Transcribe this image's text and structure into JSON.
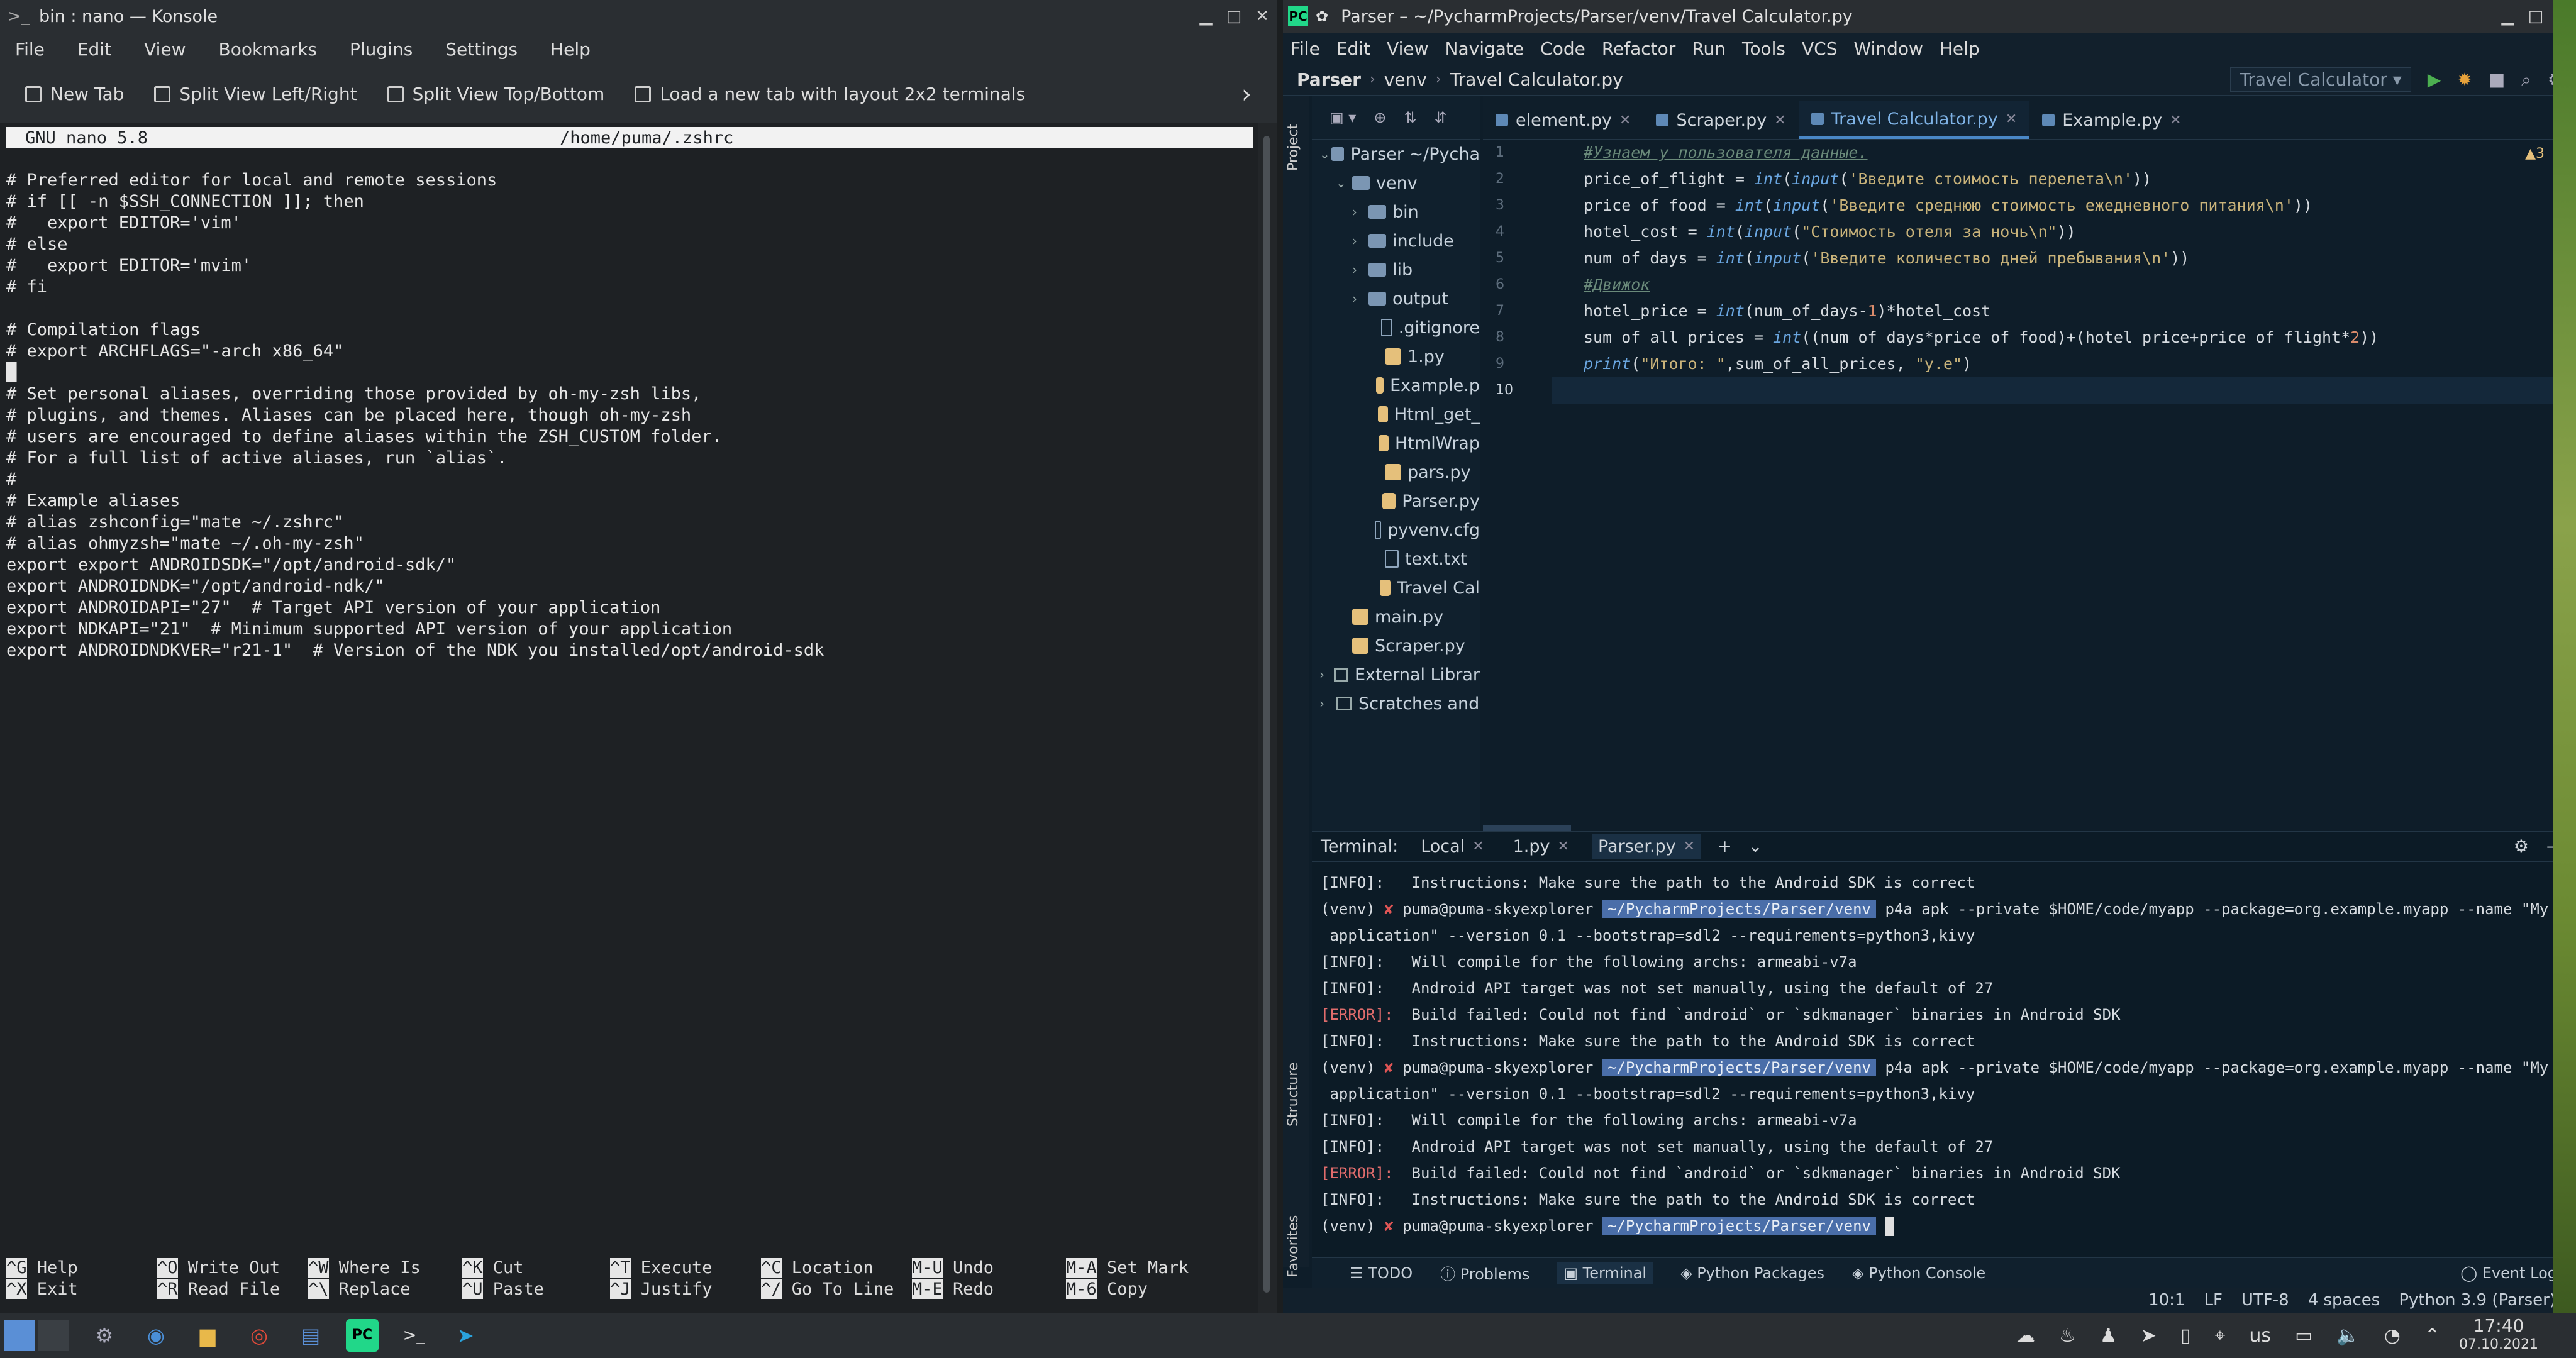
{
  "konsole": {
    "title": "bin : nano — Konsole",
    "menu": [
      "File",
      "Edit",
      "View",
      "Bookmarks",
      "Plugins",
      "Settings",
      "Help"
    ],
    "toolbar": {
      "new_tab": "New Tab",
      "split_lr": "Split View Left/Right",
      "split_tb": "Split View Top/Bottom",
      "load_layout": "Load a new tab with layout 2x2 terminals"
    },
    "nano": {
      "version": "GNU nano 5.8",
      "file": "/home/puma/.zshrc",
      "lines": [
        "# Preferred editor for local and remote sessions",
        "# if [[ -n $SSH_CONNECTION ]]; then",
        "#   export EDITOR='vim'",
        "# else",
        "#   export EDITOR='mvim'",
        "# fi",
        "",
        "# Compilation flags",
        "# export ARCHFLAGS=\"-arch x86_64\"",
        "",
        "# Set personal aliases, overriding those provided by oh-my-zsh libs,",
        "# plugins, and themes. Aliases can be placed here, though oh-my-zsh",
        "# users are encouraged to define aliases within the ZSH_CUSTOM folder.",
        "# For a full list of active aliases, run `alias`.",
        "#",
        "# Example aliases",
        "# alias zshconfig=\"mate ~/.zshrc\"",
        "# alias ohmyzsh=\"mate ~/.oh-my-zsh\"",
        "export export ANDROIDSDK=\"/opt/android-sdk/\"",
        "export ANDROIDNDK=\"/opt/android-ndk/\"",
        "export ANDROIDAPI=\"27\"  # Target API version of your application",
        "export NDKAPI=\"21\"  # Minimum supported API version of your application",
        "export ANDROIDNDKVER=\"r21-1\"  # Version of the NDK you installed/opt/android-sdk"
      ],
      "shortcuts": [
        {
          "k1": "^G",
          "l1": "Help",
          "k2": "^X",
          "l2": "Exit"
        },
        {
          "k1": "^O",
          "l1": "Write Out",
          "k2": "^R",
          "l2": "Read File"
        },
        {
          "k1": "^W",
          "l1": "Where Is",
          "k2": "^\\",
          "l2": "Replace"
        },
        {
          "k1": "^K",
          "l1": "Cut",
          "k2": "^U",
          "l2": "Paste"
        },
        {
          "k1": "^T",
          "l1": "Execute",
          "k2": "^J",
          "l2": "Justify"
        },
        {
          "k1": "^C",
          "l1": "Location",
          "k2": "^/",
          "l2": "Go To Line"
        },
        {
          "k1": "M-U",
          "l1": "Undo",
          "k2": "M-E",
          "l2": "Redo"
        },
        {
          "k1": "M-A",
          "l1": "Set Mark",
          "k2": "M-6",
          "l2": "Copy"
        }
      ]
    }
  },
  "pycharm": {
    "title": "Parser – ~/PycharmProjects/Parser/venv/Travel Calculator.py",
    "menu": [
      "File",
      "Edit",
      "View",
      "Navigate",
      "Code",
      "Refactor",
      "Run",
      "Tools",
      "VCS",
      "Window",
      "Help"
    ],
    "breadcrumb": [
      "Parser",
      "venv",
      "Travel Calculator.py"
    ],
    "run_config": "Travel Calculator",
    "side_tabs": {
      "project": "Project",
      "structure": "Structure",
      "favorites": "Favorites"
    },
    "tree": [
      {
        "label": "Parser ~/Pycha",
        "kind": "folder",
        "indent": 0,
        "open": true
      },
      {
        "label": "venv",
        "kind": "folder",
        "indent": 1,
        "open": true
      },
      {
        "label": "bin",
        "kind": "folder",
        "indent": 2,
        "open": false
      },
      {
        "label": "include",
        "kind": "folder",
        "indent": 2,
        "open": false
      },
      {
        "label": "lib",
        "kind": "folder",
        "indent": 2,
        "open": false
      },
      {
        "label": "output",
        "kind": "folder",
        "indent": 2,
        "open": false
      },
      {
        "label": ".gitignore",
        "kind": "file",
        "indent": 3
      },
      {
        "label": "1.py",
        "kind": "py",
        "indent": 3
      },
      {
        "label": "Example.p",
        "kind": "py",
        "indent": 3
      },
      {
        "label": "Html_get_",
        "kind": "py",
        "indent": 3
      },
      {
        "label": "HtmlWrap",
        "kind": "py",
        "indent": 3
      },
      {
        "label": "pars.py",
        "kind": "py",
        "indent": 3
      },
      {
        "label": "Parser.py",
        "kind": "py",
        "indent": 3
      },
      {
        "label": "pyvenv.cfg",
        "kind": "file",
        "indent": 3
      },
      {
        "label": "text.txt",
        "kind": "file",
        "indent": 3
      },
      {
        "label": "Travel Cal",
        "kind": "py",
        "indent": 3
      },
      {
        "label": "main.py",
        "kind": "py",
        "indent": 1
      },
      {
        "label": "Scraper.py",
        "kind": "py",
        "indent": 1
      },
      {
        "label": "External Librar",
        "kind": "lib",
        "indent": 0
      },
      {
        "label": "Scratches and",
        "kind": "lib",
        "indent": 0
      }
    ],
    "editor_tabs": [
      {
        "label": "element.py",
        "active": false
      },
      {
        "label": "Scraper.py",
        "active": false
      },
      {
        "label": "Travel Calculator.py",
        "active": true
      },
      {
        "label": "Example.py",
        "active": false
      }
    ],
    "warnings": "▲3",
    "code_lines": [
      "#Узнаем у пользователя данные.",
      "price_of_flight = int(input('Введите стоимость перелета\\n'))",
      "price_of_food = int(input('Введите среднюю стоимость ежедневного питания\\n'))",
      "hotel_cost = int(input(\"Стоимость отеля за ночь\\n\"))",
      "num_of_days = int(input('Введите количество дней пребывания\\n'))",
      "#Движок",
      "hotel_price = int(num_of_days-1)*hotel_cost",
      "sum_of_all_prices = int((num_of_days*price_of_food)+(hotel_price+price_of_flight*2))",
      "print(\"Итого: \",sum_of_all_prices, \"у.е\")",
      ""
    ],
    "terminal": {
      "label": "Terminal:",
      "tabs": [
        "Local",
        "1.py",
        "Parser.py"
      ],
      "lines": [
        {
          "type": "info",
          "tag": "[INFO]:",
          "text": "   Instructions: Make sure the path to the Android SDK is correct"
        },
        {
          "type": "prompt",
          "venv": "(venv)",
          "user": "puma@puma-skyexplorer",
          "path": "~/PycharmProjects/Parser/venv",
          "cmd": "p4a apk --private $HOME/code/myapp --package=org.example.myapp --name \"My"
        },
        {
          "type": "cont",
          "text": " application\" --version 0.1 --bootstrap=sdl2 --requirements=python3,kivy"
        },
        {
          "type": "info",
          "tag": "[INFO]:",
          "text": "   Will compile for the following archs: armeabi-v7a"
        },
        {
          "type": "info",
          "tag": "[INFO]:",
          "text": "   Android API target was not set manually, using the default of 27"
        },
        {
          "type": "error",
          "tag": "[ERROR]:",
          "text": "  Build failed: Could not find `android` or `sdkmanager` binaries in Android SDK"
        },
        {
          "type": "info",
          "tag": "[INFO]:",
          "text": "   Instructions: Make sure the path to the Android SDK is correct"
        },
        {
          "type": "prompt",
          "venv": "(venv)",
          "user": "puma@puma-skyexplorer",
          "path": "~/PycharmProjects/Parser/venv",
          "cmd": "p4a apk --private $HOME/code/myapp --package=org.example.myapp --name \"My"
        },
        {
          "type": "cont",
          "text": " application\" --version 0.1 --bootstrap=sdl2 --requirements=python3,kivy"
        },
        {
          "type": "info",
          "tag": "[INFO]:",
          "text": "   Will compile for the following archs: armeabi-v7a"
        },
        {
          "type": "info",
          "tag": "[INFO]:",
          "text": "   Android API target was not set manually, using the default of 27"
        },
        {
          "type": "error",
          "tag": "[ERROR]:",
          "text": "  Build failed: Could not find `android` or `sdkmanager` binaries in Android SDK"
        },
        {
          "type": "info",
          "tag": "[INFO]:",
          "text": "   Instructions: Make sure the path to the Android SDK is correct"
        },
        {
          "type": "prompt",
          "venv": "(venv)",
          "user": "puma@puma-skyexplorer",
          "path": "~/PycharmProjects/Parser/venv",
          "cmd": ""
        }
      ]
    },
    "bottom_tabs": [
      "TODO",
      "Problems",
      "Terminal",
      "Python Packages",
      "Python Console"
    ],
    "event_log": "Event Log",
    "status": [
      "10:1",
      "LF",
      "UTF-8",
      "4 spaces",
      "Python 3.9 (Parser)"
    ]
  },
  "taskbar": {
    "apps": [
      "settings-icon",
      "discover-icon",
      "files-icon",
      "chrome-icon",
      "notes-icon",
      "pycharm-icon",
      "konsole-icon",
      "telegram-icon"
    ],
    "keyboard": "us",
    "time": "17:40",
    "date": "07.10.2021"
  }
}
